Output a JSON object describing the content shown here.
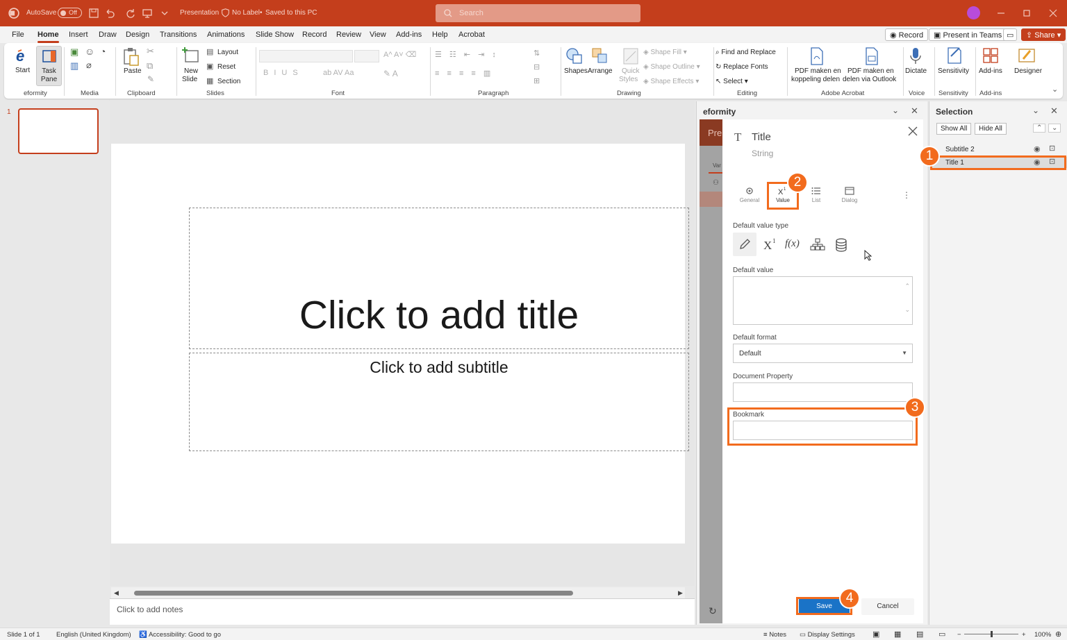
{
  "titlebar": {
    "autosave_label": "AutoSave",
    "autosave_state": "Off",
    "doc_name": "Presentation",
    "label_state": "No Label",
    "save_state": "Saved to this PC",
    "search_placeholder": "Search"
  },
  "menu": {
    "items": [
      "File",
      "Home",
      "Insert",
      "Draw",
      "Design",
      "Transitions",
      "Animations",
      "Slide Show",
      "Record",
      "Review",
      "View",
      "Add-ins",
      "Help",
      "Acrobat"
    ],
    "active": "Home",
    "record_btn": "Record",
    "present_btn": "Present in Teams",
    "share_btn": "Share"
  },
  "ribbon": {
    "eformity": {
      "start": "Start",
      "task": "Task",
      "pane": "Pane",
      "group": "eformity"
    },
    "media": {
      "group": "Media"
    },
    "clipboard": {
      "paste": "Paste",
      "group": "Clipboard"
    },
    "slides": {
      "new": "New",
      "slide": "Slide",
      "layout": "Layout",
      "reset": "Reset",
      "section": "Section",
      "group": "Slides"
    },
    "font": {
      "group": "Font"
    },
    "paragraph": {
      "group": "Paragraph"
    },
    "drawing": {
      "shapes": "Shapes",
      "arrange": "Arrange",
      "quick": "Quick",
      "styles": "Styles",
      "fill": "Shape Fill",
      "outline": "Shape Outline",
      "effects": "Shape Effects",
      "group": "Drawing"
    },
    "editing": {
      "find": "Find and Replace",
      "replace": "Replace Fonts",
      "select": "Select",
      "group": "Editing"
    },
    "acrobat": {
      "pdf1a": "PDF maken en",
      "pdf1b": "koppeling delen",
      "pdf2a": "PDF maken en",
      "pdf2b": "delen via Outlook",
      "group": "Adobe Acrobat"
    },
    "voice": {
      "dictate": "Dictate",
      "group": "Voice"
    },
    "sensitivity": {
      "label": "Sensitivity",
      "group": "Sensitivity"
    },
    "addins": {
      "label": "Add-ins",
      "group": "Add-ins"
    },
    "designer": {
      "label": "Designer"
    }
  },
  "thumbs": {
    "slide_number": "1"
  },
  "slide": {
    "title_placeholder": "Click to add title",
    "subtitle_placeholder": "Click to add subtitle"
  },
  "notes": {
    "placeholder": "Click to add notes"
  },
  "eformity": {
    "pane_title": "eformity",
    "back_text": "Pre",
    "back_tab": "Var",
    "field_title": "Title",
    "field_type": "String",
    "tabs": [
      "General",
      "Value",
      "List",
      "Dialog"
    ],
    "default_value_type_label": "Default value type",
    "default_value_label": "Default value",
    "default_format_label": "Default format",
    "default_format_value": "Default",
    "document_property_label": "Document Property",
    "bookmark_label": "Bookmark",
    "save_btn": "Save",
    "cancel_btn": "Cancel",
    "accent": "#1a73c7"
  },
  "selection": {
    "pane_title": "Selection",
    "show_all": "Show All",
    "hide_all": "Hide All",
    "items": [
      "Subtitle 2",
      "Title 1"
    ],
    "selected": "Title 1"
  },
  "callouts": [
    "1",
    "2",
    "3",
    "4"
  ],
  "callout_color": "#f26b1d",
  "status": {
    "slide": "Slide 1 of 1",
    "language": "English (United Kingdom)",
    "accessibility": "Accessibility: Good to go",
    "notes": "Notes",
    "display": "Display Settings",
    "zoom": "100%"
  }
}
